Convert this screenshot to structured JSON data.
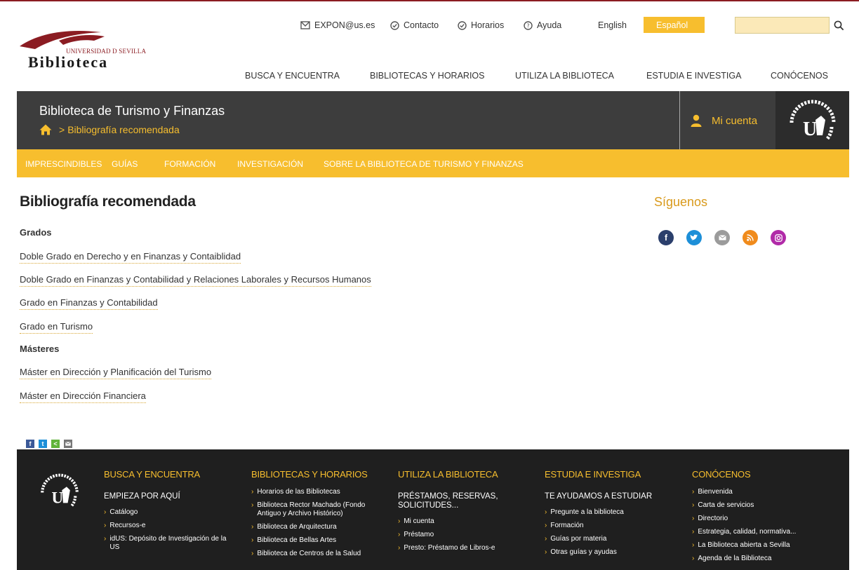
{
  "brand": {
    "univ_text": "UNIVERSIDAD D SEVILLA",
    "word": "Biblioteca"
  },
  "util_bar": {
    "email": "EXPON@us.es",
    "contact": "Contacto",
    "hours": "Horarios",
    "help": "Ayuda",
    "english": "English",
    "spanish": "Español",
    "search_value": ""
  },
  "main_nav": [
    "BUSCA Y ENCUENTRA",
    "BIBLIOTECAS Y HORARIOS",
    "UTILIZA LA BIBLIOTECA",
    "ESTUDIA E INVESTIGA",
    "CONÓCENOS"
  ],
  "banner": {
    "title": "Biblioteca de Turismo y Finanzas",
    "separator": ">",
    "crumb": "Bibliografía recomendada",
    "account": "Mi cuenta"
  },
  "sub_nav": [
    "IMPRESCINDIBLES",
    "GUÍAS",
    "FORMACIÓN",
    "INVESTIGACIÓN",
    "SOBRE LA BIBLIOTECA DE TURISMO Y FINANZAS"
  ],
  "content": {
    "title": "Bibliografía recomendada",
    "grados_heading": "Grados",
    "grados": [
      "Doble Grado en Derecho y en Finanzas y Contaiblidad",
      "Doble Grado en Finanzas y Contabilidad y Relaciones Laborales y Recursos Humanos",
      "Grado en Finanzas y Contabilidad",
      "Grado en Turismo"
    ],
    "masteres_heading": "Másteres",
    "masteres": [
      "Máster en Dirección y Planificación del Turismo",
      "Máster en Dirección Financiera"
    ]
  },
  "follow": {
    "title": "Síguenos",
    "icons": [
      "facebook-icon",
      "twitter-icon",
      "email-icon",
      "rss-icon",
      "instagram-icon"
    ]
  },
  "share_icons": [
    "facebook-share-icon",
    "twitter-share-icon",
    "share-icon",
    "email-share-icon"
  ],
  "footer": {
    "columns": [
      {
        "heading": "BUSCA Y ENCUENTRA",
        "sub": "EMPIEZA POR AQUÍ",
        "items": [
          "Catálogo",
          "Recursos-e",
          "idUS: Depósito de Investigación de la US"
        ]
      },
      {
        "heading": "BIBLIOTECAS Y HORARIOS",
        "sub": "",
        "items": [
          "Horarios de las Bibliotecas",
          "Biblioteca Rector Machado (Fondo Antiguo y Archivo Histórico)",
          "Biblioteca de Arquitectura",
          "Biblioteca de Bellas Artes",
          "Biblioteca de Centros de la Salud"
        ]
      },
      {
        "heading": "UTILIZA LA BIBLIOTECA",
        "sub": "PRÉSTAMOS, RESERVAS, SOLICITUDES...",
        "items": [
          "Mi cuenta",
          "Préstamo",
          "Presto: Préstamo de Libros-e"
        ]
      },
      {
        "heading": "ESTUDIA E INVESTIGA",
        "sub": "TE AYUDAMOS A ESTUDIAR",
        "items": [
          "Pregunte a la biblioteca",
          "Formación",
          "Guías por materia",
          "Otras guías y ayudas"
        ]
      },
      {
        "heading": "CONÓCENOS",
        "sub": "",
        "items": [
          "Bienvenida",
          "Carta de servicios",
          "Directorio",
          "Estrategia, calidad, normativa...",
          "La Biblioteca abierta a Sevilla",
          "Agenda de la Biblioteca"
        ]
      }
    ]
  },
  "colors": {
    "accent": "#f7be2e",
    "brand_red": "#8b1c22",
    "banner_bg": "#3d3d3d",
    "footer_bg": "#1f1f1f"
  }
}
